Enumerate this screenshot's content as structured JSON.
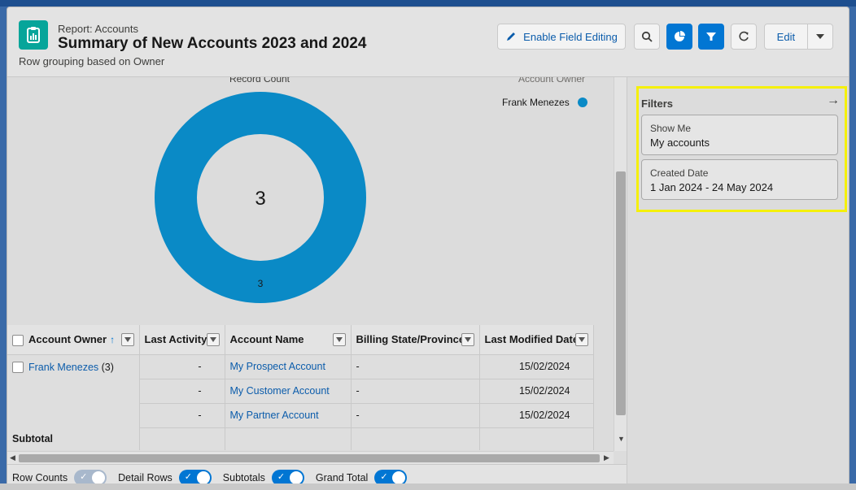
{
  "header": {
    "report_type": "Report: Accounts",
    "title": "Summary of New Accounts 2023 and 2024",
    "subtitle": "Row grouping based on Owner",
    "enable_field_editing": "Enable Field Editing",
    "edit": "Edit"
  },
  "chart": {
    "title": "Record Count",
    "legend_title": "Account Owner",
    "legend_item": "Frank Menezes",
    "total_label": "3",
    "slice_label": "3",
    "color": "#0a8ac6"
  },
  "chart_data": {
    "type": "pie",
    "title": "Record Count",
    "categories": [
      "Frank Menezes"
    ],
    "values": [
      3
    ],
    "total": 3,
    "legend_title": "Account Owner",
    "legend_placement": "top-right"
  },
  "table": {
    "columns": [
      "Account Owner",
      "Last Activity",
      "Account Name",
      "Billing State/Province",
      "Last Modified Date"
    ],
    "group_label": "Frank Menezes",
    "group_count": "(3)",
    "rows": [
      {
        "last_activity": "-",
        "account_name": "My Prospect Account",
        "billing_state": "-",
        "last_modified": "15/02/2024"
      },
      {
        "last_activity": "-",
        "account_name": "My Customer Account",
        "billing_state": "-",
        "last_modified": "15/02/2024"
      },
      {
        "last_activity": "-",
        "account_name": "My Partner Account",
        "billing_state": "-",
        "last_modified": "15/02/2024"
      }
    ],
    "subtotal_label": "Subtotal"
  },
  "footer": {
    "row_counts": "Row Counts",
    "detail_rows": "Detail Rows",
    "subtotals": "Subtotals",
    "grand_total": "Grand Total",
    "row_counts_on": false,
    "detail_rows_on": true,
    "subtotals_on": true,
    "grand_total_on": true
  },
  "filters": {
    "title": "Filters",
    "items": [
      {
        "label": "Show Me",
        "value": "My accounts"
      },
      {
        "label": "Created Date",
        "value": "1 Jan 2024 - 24 May 2024"
      }
    ]
  }
}
